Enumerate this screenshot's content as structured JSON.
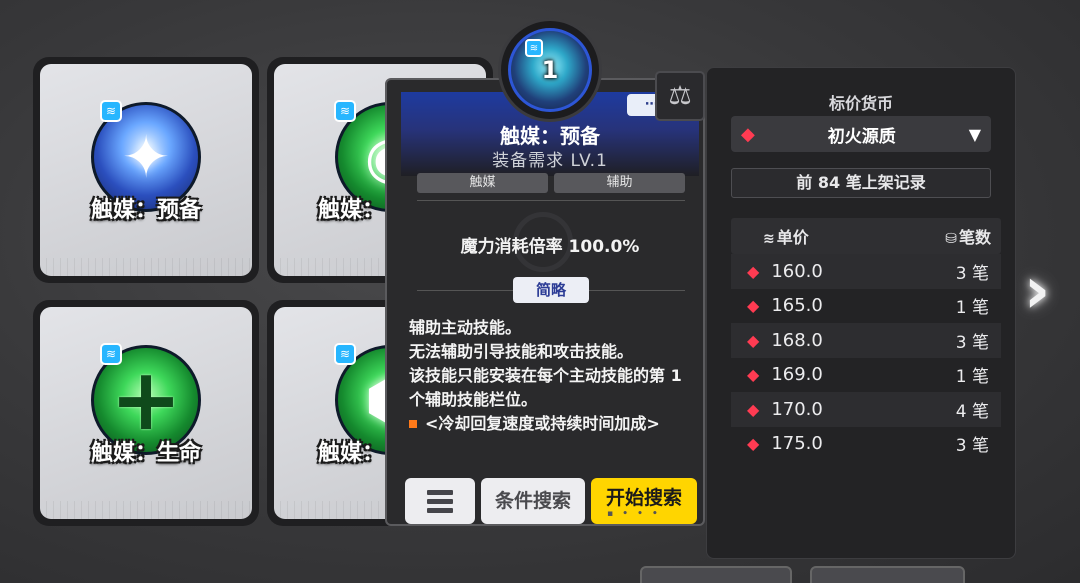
{
  "tiles": [
    {
      "label": "触媒：预备",
      "orb": "blue"
    },
    {
      "label": "触媒：",
      "orb": "green"
    },
    {
      "label": "触媒：生命",
      "orb": "green-plus"
    },
    {
      "label": "触媒：",
      "orb": "green"
    }
  ],
  "medallion": {
    "number": "1"
  },
  "detail": {
    "title": "触媒：预备",
    "requirement": "装备需求 LV.1",
    "tags": [
      "触媒",
      "辅助"
    ],
    "stat": "魔力消耗倍率 100.0%",
    "tab": "简略",
    "description": [
      "辅助主动技能。",
      "无法辅助引导技能和攻击技能。",
      "该技能只能安装在每个主动技能的第 1 个辅助技能栏位。"
    ],
    "bullet": "<冷却回复速度或持续时间加成>",
    "buttons": {
      "condition_search": "条件搜索",
      "start_search": "开始搜索"
    }
  },
  "market": {
    "title": "标价货币",
    "currency": "初火源质",
    "record": "前 84 笔上架记录",
    "headers": {
      "price": "单价",
      "count": "笔数"
    },
    "rows": [
      {
        "price": "160.0",
        "count": "3 笔"
      },
      {
        "price": "165.0",
        "count": "1 笔"
      },
      {
        "price": "168.0",
        "count": "3 笔"
      },
      {
        "price": "169.0",
        "count": "1 笔"
      },
      {
        "price": "170.0",
        "count": "4 笔"
      },
      {
        "price": "175.0",
        "count": "3 笔"
      }
    ]
  }
}
